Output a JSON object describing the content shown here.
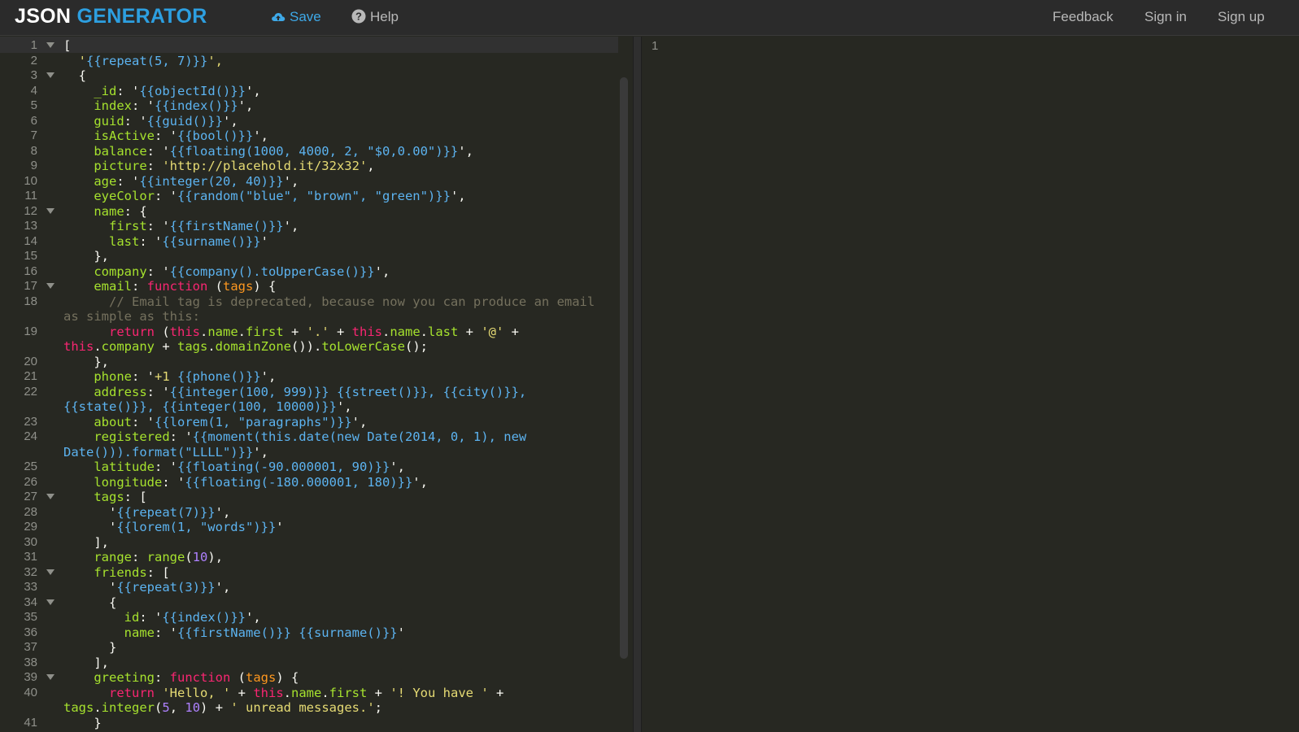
{
  "logo": {
    "part1": "JSON ",
    "part2": "GENERATOR"
  },
  "nav": {
    "save": "Save",
    "help": "Help"
  },
  "right_nav": {
    "feedback": "Feedback",
    "signin": "Sign in",
    "signup": "Sign up"
  },
  "colors": {
    "accent": "#2d9fe0",
    "background": "#272822"
  },
  "output": {
    "line_number": "1"
  },
  "editor": {
    "lines": [
      {
        "n": "1",
        "fold": true,
        "tokens": [
          [
            "[",
            "plain"
          ]
        ]
      },
      {
        "n": "2",
        "tokens": [
          [
            "  '",
            "str"
          ],
          [
            "{{repeat(5, 7)}}",
            "tpl"
          ],
          [
            "',",
            "str"
          ]
        ]
      },
      {
        "n": "3",
        "fold": true,
        "tokens": [
          [
            "  {",
            "plain"
          ]
        ]
      },
      {
        "n": "4",
        "tokens": [
          [
            "    _id",
            "key"
          ],
          [
            ": '",
            "plain"
          ],
          [
            "{{objectId()}}",
            "tpl"
          ],
          [
            "',",
            "plain"
          ]
        ]
      },
      {
        "n": "5",
        "tokens": [
          [
            "    index",
            "key"
          ],
          [
            ": '",
            "plain"
          ],
          [
            "{{index()}}",
            "tpl"
          ],
          [
            "',",
            "plain"
          ]
        ]
      },
      {
        "n": "6",
        "tokens": [
          [
            "    guid",
            "key"
          ],
          [
            ": '",
            "plain"
          ],
          [
            "{{guid()}}",
            "tpl"
          ],
          [
            "',",
            "plain"
          ]
        ]
      },
      {
        "n": "7",
        "tokens": [
          [
            "    isActive",
            "key"
          ],
          [
            ": '",
            "plain"
          ],
          [
            "{{bool()}}",
            "tpl"
          ],
          [
            "',",
            "plain"
          ]
        ]
      },
      {
        "n": "8",
        "tokens": [
          [
            "    balance",
            "key"
          ],
          [
            ": '",
            "plain"
          ],
          [
            "{{floating(1000, 4000, 2, \"$0,0.00\")}}",
            "tpl"
          ],
          [
            "',",
            "plain"
          ]
        ]
      },
      {
        "n": "9",
        "tokens": [
          [
            "    picture",
            "key"
          ],
          [
            ": ",
            "plain"
          ],
          [
            "'http://placehold.it/32x32'",
            "str"
          ],
          [
            ",",
            "plain"
          ]
        ]
      },
      {
        "n": "10",
        "tokens": [
          [
            "    age",
            "key"
          ],
          [
            ": '",
            "plain"
          ],
          [
            "{{integer(20, 40)}}",
            "tpl"
          ],
          [
            "',",
            "plain"
          ]
        ]
      },
      {
        "n": "11",
        "tokens": [
          [
            "    eyeColor",
            "key"
          ],
          [
            ": '",
            "plain"
          ],
          [
            "{{random(\"blue\", \"brown\", \"green\")}}",
            "tpl"
          ],
          [
            "',",
            "plain"
          ]
        ]
      },
      {
        "n": "12",
        "fold": true,
        "tokens": [
          [
            "    name",
            "key"
          ],
          [
            ": {",
            "plain"
          ]
        ]
      },
      {
        "n": "13",
        "tokens": [
          [
            "      first",
            "key"
          ],
          [
            ": '",
            "plain"
          ],
          [
            "{{firstName()}}",
            "tpl"
          ],
          [
            "',",
            "plain"
          ]
        ]
      },
      {
        "n": "14",
        "tokens": [
          [
            "      last",
            "key"
          ],
          [
            ": '",
            "plain"
          ],
          [
            "{{surname()}}",
            "tpl"
          ],
          [
            "'",
            "plain"
          ]
        ]
      },
      {
        "n": "15",
        "tokens": [
          [
            "    },",
            "plain"
          ]
        ]
      },
      {
        "n": "16",
        "tokens": [
          [
            "    company",
            "key"
          ],
          [
            ": '",
            "plain"
          ],
          [
            "{{company().toUpperCase()}}",
            "tpl"
          ],
          [
            "',",
            "plain"
          ]
        ]
      },
      {
        "n": "17",
        "fold": true,
        "tokens": [
          [
            "    email",
            "key"
          ],
          [
            ": ",
            "plain"
          ],
          [
            "function",
            "kw"
          ],
          [
            " (",
            "plain"
          ],
          [
            "tags",
            "param"
          ],
          [
            ") {",
            "plain"
          ]
        ]
      },
      {
        "n": "18",
        "tokens": [
          [
            "      // Email tag is deprecated, because now you can produce an email",
            "com"
          ]
        ]
      },
      {
        "n": "",
        "tokens": [
          [
            "as simple as this:",
            "com"
          ]
        ]
      },
      {
        "n": "19",
        "tokens": [
          [
            "      return",
            "kw"
          ],
          [
            " (",
            "plain"
          ],
          [
            "this",
            "kw"
          ],
          [
            ".",
            "plain"
          ],
          [
            "name",
            "key"
          ],
          [
            ".",
            "plain"
          ],
          [
            "first",
            "key"
          ],
          [
            " + ",
            "plain"
          ],
          [
            "'.'",
            "str"
          ],
          [
            " + ",
            "plain"
          ],
          [
            "this",
            "kw"
          ],
          [
            ".",
            "plain"
          ],
          [
            "name",
            "key"
          ],
          [
            ".",
            "plain"
          ],
          [
            "last",
            "key"
          ],
          [
            " + ",
            "plain"
          ],
          [
            "'@'",
            "str"
          ],
          [
            " +",
            "plain"
          ]
        ]
      },
      {
        "n": "",
        "tokens": [
          [
            "this",
            "kw"
          ],
          [
            ".",
            "plain"
          ],
          [
            "company",
            "key"
          ],
          [
            " + ",
            "plain"
          ],
          [
            "tags",
            "key"
          ],
          [
            ".",
            "plain"
          ],
          [
            "domainZone",
            "fn"
          ],
          [
            "()).",
            "plain"
          ],
          [
            "toLowerCase",
            "fn"
          ],
          [
            "();",
            "plain"
          ]
        ]
      },
      {
        "n": "20",
        "tokens": [
          [
            "    },",
            "plain"
          ]
        ]
      },
      {
        "n": "21",
        "tokens": [
          [
            "    phone",
            "key"
          ],
          [
            ": '",
            "plain"
          ],
          [
            "+1 ",
            "str"
          ],
          [
            "{{phone()}}",
            "tpl"
          ],
          [
            "',",
            "plain"
          ]
        ]
      },
      {
        "n": "22",
        "tokens": [
          [
            "    address",
            "key"
          ],
          [
            ": '",
            "plain"
          ],
          [
            "{{integer(100, 999)}} {{street()}}, {{city()}},",
            "tpl"
          ]
        ]
      },
      {
        "n": "",
        "tokens": [
          [
            "{{state()}}, {{integer(100, 10000)}}",
            "tpl"
          ],
          [
            "',",
            "plain"
          ]
        ]
      },
      {
        "n": "23",
        "tokens": [
          [
            "    about",
            "key"
          ],
          [
            ": '",
            "plain"
          ],
          [
            "{{lorem(1, \"paragraphs\")}}",
            "tpl"
          ],
          [
            "',",
            "plain"
          ]
        ]
      },
      {
        "n": "24",
        "tokens": [
          [
            "    registered",
            "key"
          ],
          [
            ": '",
            "plain"
          ],
          [
            "{{moment(this.date(new Date(2014, 0, 1), new",
            "tpl"
          ]
        ]
      },
      {
        "n": "",
        "tokens": [
          [
            "Date())).format(\"LLLL\")}}",
            "tpl"
          ],
          [
            "',",
            "plain"
          ]
        ]
      },
      {
        "n": "25",
        "tokens": [
          [
            "    latitude",
            "key"
          ],
          [
            ": '",
            "plain"
          ],
          [
            "{{floating(-90.000001, 90)}}",
            "tpl"
          ],
          [
            "',",
            "plain"
          ]
        ]
      },
      {
        "n": "26",
        "tokens": [
          [
            "    longitude",
            "key"
          ],
          [
            ": '",
            "plain"
          ],
          [
            "{{floating(-180.000001, 180)}}",
            "tpl"
          ],
          [
            "',",
            "plain"
          ]
        ]
      },
      {
        "n": "27",
        "fold": true,
        "tokens": [
          [
            "    tags",
            "key"
          ],
          [
            ": [",
            "plain"
          ]
        ]
      },
      {
        "n": "28",
        "tokens": [
          [
            "      '",
            "plain"
          ],
          [
            "{{repeat(7)}}",
            "tpl"
          ],
          [
            "',",
            "plain"
          ]
        ]
      },
      {
        "n": "29",
        "tokens": [
          [
            "      '",
            "plain"
          ],
          [
            "{{lorem(1, \"words\")}}",
            "tpl"
          ],
          [
            "'",
            "plain"
          ]
        ]
      },
      {
        "n": "30",
        "tokens": [
          [
            "    ],",
            "plain"
          ]
        ]
      },
      {
        "n": "31",
        "tokens": [
          [
            "    range",
            "key"
          ],
          [
            ": ",
            "plain"
          ],
          [
            "range",
            "fn"
          ],
          [
            "(",
            "plain"
          ],
          [
            "10",
            "num"
          ],
          [
            "),",
            "plain"
          ]
        ]
      },
      {
        "n": "32",
        "fold": true,
        "tokens": [
          [
            "    friends",
            "key"
          ],
          [
            ": [",
            "plain"
          ]
        ]
      },
      {
        "n": "33",
        "tokens": [
          [
            "      '",
            "plain"
          ],
          [
            "{{repeat(3)}}",
            "tpl"
          ],
          [
            "',",
            "plain"
          ]
        ]
      },
      {
        "n": "34",
        "fold": true,
        "tokens": [
          [
            "      {",
            "plain"
          ]
        ]
      },
      {
        "n": "35",
        "tokens": [
          [
            "        id",
            "key"
          ],
          [
            ": '",
            "plain"
          ],
          [
            "{{index()}}",
            "tpl"
          ],
          [
            "',",
            "plain"
          ]
        ]
      },
      {
        "n": "36",
        "tokens": [
          [
            "        name",
            "key"
          ],
          [
            ": '",
            "plain"
          ],
          [
            "{{firstName()}} {{surname()}}",
            "tpl"
          ],
          [
            "'",
            "plain"
          ]
        ]
      },
      {
        "n": "37",
        "tokens": [
          [
            "      }",
            "plain"
          ]
        ]
      },
      {
        "n": "38",
        "tokens": [
          [
            "    ],",
            "plain"
          ]
        ]
      },
      {
        "n": "39",
        "fold": true,
        "tokens": [
          [
            "    greeting",
            "key"
          ],
          [
            ": ",
            "plain"
          ],
          [
            "function",
            "kw"
          ],
          [
            " (",
            "plain"
          ],
          [
            "tags",
            "param"
          ],
          [
            ") {",
            "plain"
          ]
        ]
      },
      {
        "n": "40",
        "tokens": [
          [
            "      return",
            "kw"
          ],
          [
            " ",
            "plain"
          ],
          [
            "'Hello, '",
            "str"
          ],
          [
            " + ",
            "plain"
          ],
          [
            "this",
            "kw"
          ],
          [
            ".",
            "plain"
          ],
          [
            "name",
            "key"
          ],
          [
            ".",
            "plain"
          ],
          [
            "first",
            "key"
          ],
          [
            " + ",
            "plain"
          ],
          [
            "'! You have '",
            "str"
          ],
          [
            " +",
            "plain"
          ]
        ]
      },
      {
        "n": "",
        "tokens": [
          [
            "tags",
            "key"
          ],
          [
            ".",
            "plain"
          ],
          [
            "integer",
            "fn"
          ],
          [
            "(",
            "plain"
          ],
          [
            "5",
            "num"
          ],
          [
            ", ",
            "plain"
          ],
          [
            "10",
            "num"
          ],
          [
            ") + ",
            "plain"
          ],
          [
            "' unread messages.'",
            "str"
          ],
          [
            ";",
            "plain"
          ]
        ]
      },
      {
        "n": "41",
        "tokens": [
          [
            "    }",
            "plain"
          ]
        ]
      }
    ]
  }
}
